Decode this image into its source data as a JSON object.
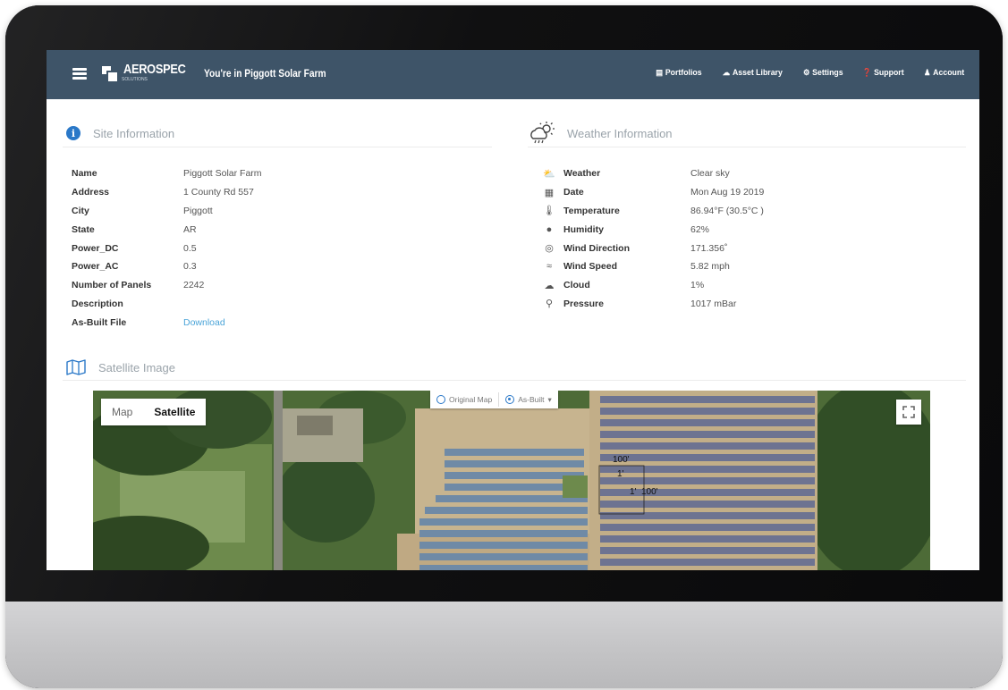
{
  "header": {
    "brand": "AEROSPEC",
    "brand_sub": "SOLUTIONS",
    "site_title": "You're in Piggott Solar Farm",
    "nav": [
      {
        "label": "Portfolios",
        "icon": "grid-icon"
      },
      {
        "label": "Asset Library",
        "icon": "cloud-icon"
      },
      {
        "label": "Settings",
        "icon": "gear-icon"
      },
      {
        "label": "Support",
        "icon": "question-icon"
      },
      {
        "label": "Account",
        "icon": "user-icon"
      }
    ]
  },
  "site": {
    "title": "Site Information",
    "rows": [
      {
        "key": "Name",
        "value": "Piggott Solar Farm"
      },
      {
        "key": "Address",
        "value": "1 County Rd 557"
      },
      {
        "key": "City",
        "value": "Piggott"
      },
      {
        "key": "State",
        "value": "AR"
      },
      {
        "key": "Power_DC",
        "value": "0.5"
      },
      {
        "key": "Power_AC",
        "value": "0.3"
      },
      {
        "key": "Number of Panels",
        "value": "2242"
      },
      {
        "key": "Description",
        "value": ""
      },
      {
        "key": "As-Built File",
        "value": "Download"
      }
    ]
  },
  "weather": {
    "title": "Weather Information",
    "rows": [
      {
        "key": "Weather",
        "value": "Clear sky",
        "icon": "cloud-sun-icon"
      },
      {
        "key": "Date",
        "value": "Mon Aug 19 2019",
        "icon": "calendar-icon"
      },
      {
        "key": "Temperature",
        "value": "86.94°F  (30.5°C )",
        "icon": "thermometer-icon"
      },
      {
        "key": "Humidity",
        "value": "62%",
        "icon": "droplet-icon"
      },
      {
        "key": "Wind Direction",
        "value": "171.356˚",
        "icon": "compass-icon"
      },
      {
        "key": "Wind Speed",
        "value": "5.82 mph",
        "icon": "wind-icon"
      },
      {
        "key": "Cloud",
        "value": "1%",
        "icon": "cloud-icon"
      },
      {
        "key": "Pressure",
        "value": "1017 mBar",
        "icon": "pin-icon"
      }
    ]
  },
  "satellite": {
    "title": "Satellite Image",
    "map_types": [
      "Map",
      "Satellite"
    ],
    "selected_map_type": "Satellite",
    "overlay_options": [
      "Original Map",
      "As-Built"
    ],
    "selected_overlay": "As-Built",
    "measurements": [
      "100'",
      "1'",
      "1'",
      "100'"
    ]
  }
}
